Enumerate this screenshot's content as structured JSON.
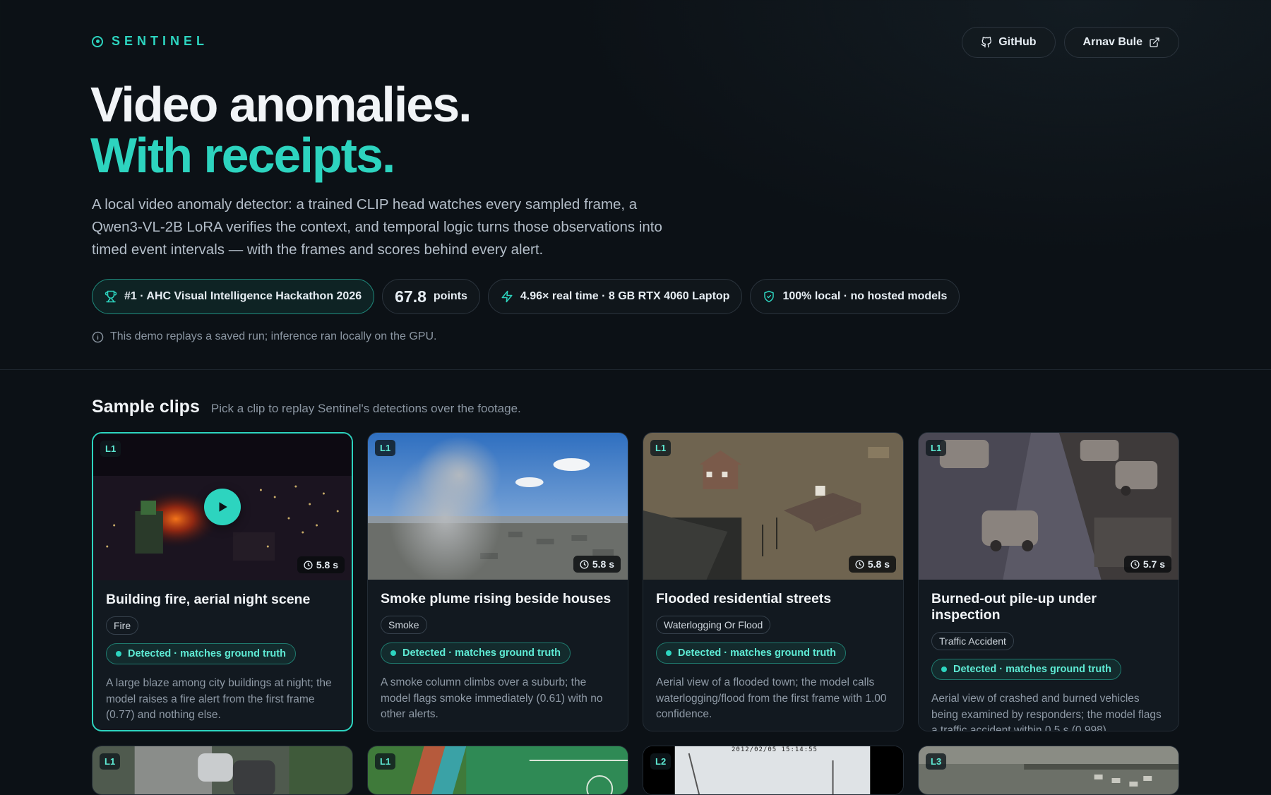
{
  "brand": {
    "name": "SENTINEL"
  },
  "nav": {
    "github_label": "GitHub",
    "author_label": "Arnav Bule"
  },
  "hero": {
    "title_line1": "Video anomalies.",
    "title_line2": "With receipts.",
    "description": "A local video anomaly detector: a trained CLIP head watches every sampled frame, a Qwen3-VL-2B LoRA verifies the context, and temporal logic turns those observations into timed event intervals — with the frames and scores behind every alert."
  },
  "badges": {
    "award": "#1 · AHC Visual Intelligence Hackathon 2026",
    "points_value": "67.8",
    "points_label": "points",
    "speed": "4.96× real time · 8 GB RTX 4060 Laptop",
    "local": "100% local · no hosted models"
  },
  "note": "This demo replays a saved run; inference ran locally on the GPU.",
  "section": {
    "title": "Sample clips",
    "subtitle": "Pick a clip to replay Sentinel's detections over the footage."
  },
  "clips": [
    {
      "level": "L1",
      "duration": "5.8 s",
      "title": "Building fire, aerial night scene",
      "tag": "Fire",
      "status": "Detected · matches ground truth",
      "description": "A large blaze among city buildings at night; the model raises a fire alert from the first frame (0.77) and nothing else."
    },
    {
      "level": "L1",
      "duration": "5.8 s",
      "title": "Smoke plume rising beside houses",
      "tag": "Smoke",
      "status": "Detected · matches ground truth",
      "description": "A smoke column climbs over a suburb; the model flags smoke immediately (0.61) with no other alerts."
    },
    {
      "level": "L1",
      "duration": "5.8 s",
      "title": "Flooded residential streets",
      "tag": "Waterlogging Or Flood",
      "status": "Detected · matches ground truth",
      "description": "Aerial view of a flooded town; the model calls waterlogging/flood from the first frame with 1.00 confidence."
    },
    {
      "level": "L1",
      "duration": "5.7 s",
      "title": "Burned-out pile-up under inspection",
      "tag": "Traffic Accident",
      "status": "Detected · matches ground truth",
      "description": "Aerial view of crashed and burned vehicles being examined by responders; the model flags a traffic accident within 0.5 s (0.998)."
    },
    {
      "level": "L1"
    },
    {
      "level": "L1"
    },
    {
      "level": "L2",
      "timestamp": "2012/02/05 15:14:55"
    },
    {
      "level": "L3"
    }
  ],
  "colors": {
    "accent": "#2dd4bf",
    "background": "#0c1116"
  }
}
